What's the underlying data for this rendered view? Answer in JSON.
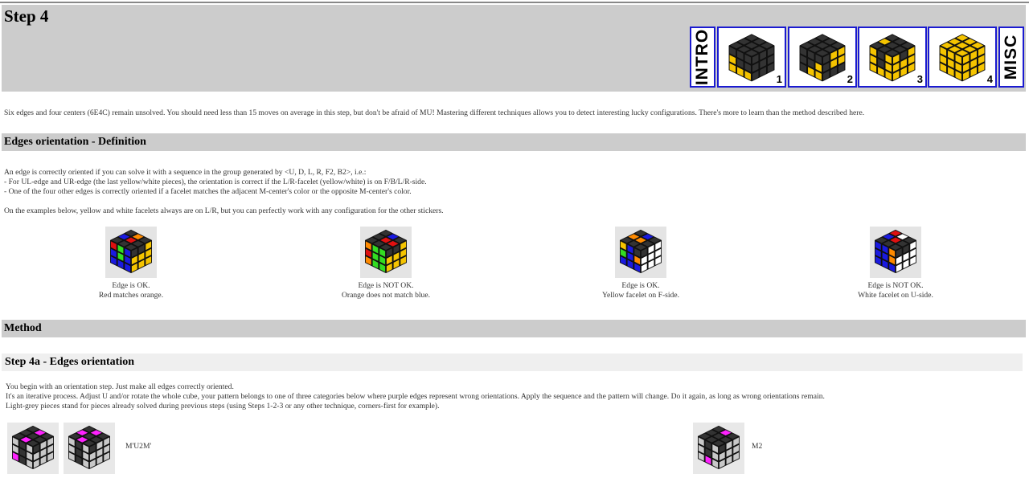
{
  "header": {
    "title": "Step 4",
    "nav": {
      "intro": "INTRO",
      "misc": "MISC",
      "steps": [
        {
          "num": "1"
        },
        {
          "num": "2"
        },
        {
          "num": "3"
        },
        {
          "num": "4"
        }
      ]
    }
  },
  "intro_text": "Six edges and four centers (6E4C) remain unsolved. You should need less than 15 moves on average in this step, but don't be afraid of MU! Mastering different techniques allows you to detect interesting lucky configurations. There's more to learn than the method described here.",
  "definition": {
    "heading": "Edges orientation - Definition",
    "lines": [
      "An edge is correctly oriented if you can solve it with a sequence in the group generated by <U, D, L, R, F2, B2>, i.e.:",
      "- For UL-edge and UR-edge (the last yellow/white pieces), the orientation is correct if the L/R-facelet (yellow/white) is on F/B/L/R-side.",
      "- One of the four other edges is correctly oriented if a facelet matches the adjacent M-center's color or the opposite M-center's color."
    ],
    "note": "On the examples below, yellow and white facelets always are on L/R, but you can perfectly work with any configuration for the other stickers.",
    "examples": [
      {
        "line1": "Edge is OK.",
        "line2": "Red matches orange."
      },
      {
        "line1": "Edge is NOT OK.",
        "line2": "Orange does not match blue."
      },
      {
        "line1": "Edge is OK.",
        "line2": "Yellow facelet on F-side."
      },
      {
        "line1": "Edge is NOT OK.",
        "line2": "White facelet on U-side."
      }
    ]
  },
  "method": {
    "heading": "Method",
    "step4a": {
      "heading": "Step 4a - Edges orientation",
      "lines": [
        "You begin with an orientation step. Just make all edges correctly oriented.",
        "It's an iterative process. Adjust U and/or rotate the whole cube, your pattern belongs to one of three categories below where purple edges represent wrong orientations. Apply the sequence and the pattern will change. Do it again, as long as wrong orientations remain.",
        "Light-grey pieces stand for pieces already solved during previous steps (using Steps 1-2-3 or any other technique, corners-first for example)."
      ],
      "algs": [
        {
          "sequence": "M'U2M'"
        },
        {
          "sequence": "M2"
        }
      ]
    }
  },
  "colors": {
    "header_bg": "#cccccc",
    "nav_border": "#1a1ad0",
    "subsection_bg": "#efefef",
    "purple": "#ff22ff"
  }
}
